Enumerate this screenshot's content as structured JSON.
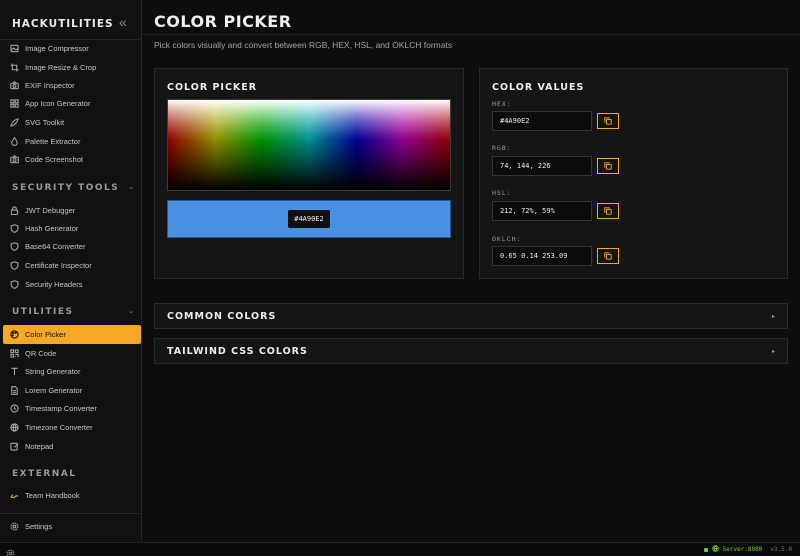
{
  "sidebar": {
    "brand": "HACKUTILITIES",
    "collapse_icon": "chevrons-left-icon",
    "image_tools": [
      {
        "label": "Image Compressor",
        "icon": "image-icon"
      },
      {
        "label": "Image Resize & Crop",
        "icon": "crop-icon"
      },
      {
        "label": "EXIF Inspector",
        "icon": "camera-icon"
      },
      {
        "label": "App Icon Generator",
        "icon": "grid-icon"
      },
      {
        "label": "SVG Toolkit",
        "icon": "pen-icon"
      },
      {
        "label": "Palette Extractor",
        "icon": "droplet-icon"
      },
      {
        "label": "Code Screenshot",
        "icon": "camera-icon"
      }
    ],
    "security": {
      "title": "SECURITY TOOLS",
      "items": [
        {
          "label": "JWT Debugger",
          "icon": "lock-icon"
        },
        {
          "label": "Hash Generator",
          "icon": "shield-icon"
        },
        {
          "label": "Base64 Converter",
          "icon": "shield-icon"
        },
        {
          "label": "Certificate Inspector",
          "icon": "shield-icon"
        },
        {
          "label": "Security Headers",
          "icon": "shield-icon"
        }
      ]
    },
    "utilities": {
      "title": "UTILITIES",
      "items": [
        {
          "label": "Color Picker",
          "icon": "palette-icon",
          "active": true
        },
        {
          "label": "QR Code",
          "icon": "qr-icon"
        },
        {
          "label": "String Generator",
          "icon": "type-icon"
        },
        {
          "label": "Lorem Generator",
          "icon": "file-icon"
        },
        {
          "label": "Timestamp Converter",
          "icon": "clock-icon"
        },
        {
          "label": "Timezone Converter",
          "icon": "globe-icon"
        },
        {
          "label": "Notepad",
          "icon": "edit-icon"
        }
      ]
    },
    "external": {
      "title": "EXTERNAL",
      "items": [
        {
          "label": "Team Handbook",
          "icon": "book-icon"
        }
      ]
    },
    "settings": {
      "label": "Settings",
      "icon": "gear-icon"
    }
  },
  "main": {
    "title": "COLOR PICKER",
    "subtitle": "Pick colors visually and convert between RGB, HEX, HSL, and OKLCH formats",
    "picker": {
      "title": "COLOR PICKER",
      "current_hex": "#4A90E2",
      "current_color": "#4a90e2"
    },
    "values": {
      "title": "COLOR VALUES",
      "fields": [
        {
          "label": "HEX:",
          "value": "#4A90E2"
        },
        {
          "label": "RGB:",
          "value": "74, 144, 226"
        },
        {
          "label": "HSL:",
          "value": "212, 72%, 59%"
        },
        {
          "label": "OKLCH:",
          "value": "0.65 0.14 253.09"
        }
      ]
    },
    "accordions": [
      {
        "title": "COMMON COLORS",
        "arrow": "▸"
      },
      {
        "title": "TAILWIND CSS COLORS",
        "arrow": "▸"
      }
    ]
  },
  "status": {
    "server": "Server:8080",
    "version": "v3.5.0"
  },
  "colors": {
    "accent": "#f4a824",
    "status_green": "#6fcf3a"
  }
}
